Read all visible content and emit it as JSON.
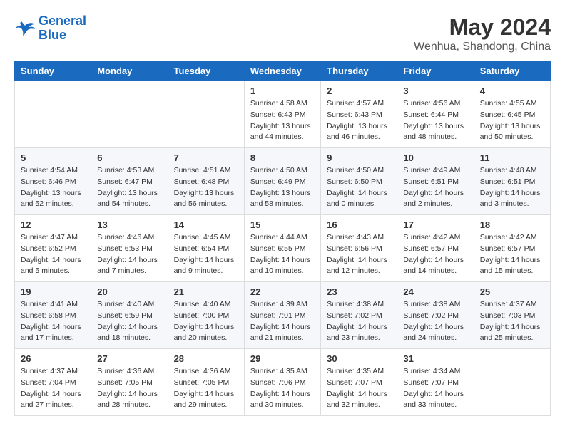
{
  "logo": {
    "line1": "General",
    "line2": "Blue"
  },
  "title": {
    "month_year": "May 2024",
    "location": "Wenhua, Shandong, China"
  },
  "days_of_week": [
    "Sunday",
    "Monday",
    "Tuesday",
    "Wednesday",
    "Thursday",
    "Friday",
    "Saturday"
  ],
  "weeks": [
    [
      {
        "day": "",
        "info": ""
      },
      {
        "day": "",
        "info": ""
      },
      {
        "day": "",
        "info": ""
      },
      {
        "day": "1",
        "info": "Sunrise: 4:58 AM\nSunset: 6:43 PM\nDaylight: 13 hours\nand 44 minutes."
      },
      {
        "day": "2",
        "info": "Sunrise: 4:57 AM\nSunset: 6:43 PM\nDaylight: 13 hours\nand 46 minutes."
      },
      {
        "day": "3",
        "info": "Sunrise: 4:56 AM\nSunset: 6:44 PM\nDaylight: 13 hours\nand 48 minutes."
      },
      {
        "day": "4",
        "info": "Sunrise: 4:55 AM\nSunset: 6:45 PM\nDaylight: 13 hours\nand 50 minutes."
      }
    ],
    [
      {
        "day": "5",
        "info": "Sunrise: 4:54 AM\nSunset: 6:46 PM\nDaylight: 13 hours\nand 52 minutes."
      },
      {
        "day": "6",
        "info": "Sunrise: 4:53 AM\nSunset: 6:47 PM\nDaylight: 13 hours\nand 54 minutes."
      },
      {
        "day": "7",
        "info": "Sunrise: 4:51 AM\nSunset: 6:48 PM\nDaylight: 13 hours\nand 56 minutes."
      },
      {
        "day": "8",
        "info": "Sunrise: 4:50 AM\nSunset: 6:49 PM\nDaylight: 13 hours\nand 58 minutes."
      },
      {
        "day": "9",
        "info": "Sunrise: 4:50 AM\nSunset: 6:50 PM\nDaylight: 14 hours\nand 0 minutes."
      },
      {
        "day": "10",
        "info": "Sunrise: 4:49 AM\nSunset: 6:51 PM\nDaylight: 14 hours\nand 2 minutes."
      },
      {
        "day": "11",
        "info": "Sunrise: 4:48 AM\nSunset: 6:51 PM\nDaylight: 14 hours\nand 3 minutes."
      }
    ],
    [
      {
        "day": "12",
        "info": "Sunrise: 4:47 AM\nSunset: 6:52 PM\nDaylight: 14 hours\nand 5 minutes."
      },
      {
        "day": "13",
        "info": "Sunrise: 4:46 AM\nSunset: 6:53 PM\nDaylight: 14 hours\nand 7 minutes."
      },
      {
        "day": "14",
        "info": "Sunrise: 4:45 AM\nSunset: 6:54 PM\nDaylight: 14 hours\nand 9 minutes."
      },
      {
        "day": "15",
        "info": "Sunrise: 4:44 AM\nSunset: 6:55 PM\nDaylight: 14 hours\nand 10 minutes."
      },
      {
        "day": "16",
        "info": "Sunrise: 4:43 AM\nSunset: 6:56 PM\nDaylight: 14 hours\nand 12 minutes."
      },
      {
        "day": "17",
        "info": "Sunrise: 4:42 AM\nSunset: 6:57 PM\nDaylight: 14 hours\nand 14 minutes."
      },
      {
        "day": "18",
        "info": "Sunrise: 4:42 AM\nSunset: 6:57 PM\nDaylight: 14 hours\nand 15 minutes."
      }
    ],
    [
      {
        "day": "19",
        "info": "Sunrise: 4:41 AM\nSunset: 6:58 PM\nDaylight: 14 hours\nand 17 minutes."
      },
      {
        "day": "20",
        "info": "Sunrise: 4:40 AM\nSunset: 6:59 PM\nDaylight: 14 hours\nand 18 minutes."
      },
      {
        "day": "21",
        "info": "Sunrise: 4:40 AM\nSunset: 7:00 PM\nDaylight: 14 hours\nand 20 minutes."
      },
      {
        "day": "22",
        "info": "Sunrise: 4:39 AM\nSunset: 7:01 PM\nDaylight: 14 hours\nand 21 minutes."
      },
      {
        "day": "23",
        "info": "Sunrise: 4:38 AM\nSunset: 7:02 PM\nDaylight: 14 hours\nand 23 minutes."
      },
      {
        "day": "24",
        "info": "Sunrise: 4:38 AM\nSunset: 7:02 PM\nDaylight: 14 hours\nand 24 minutes."
      },
      {
        "day": "25",
        "info": "Sunrise: 4:37 AM\nSunset: 7:03 PM\nDaylight: 14 hours\nand 25 minutes."
      }
    ],
    [
      {
        "day": "26",
        "info": "Sunrise: 4:37 AM\nSunset: 7:04 PM\nDaylight: 14 hours\nand 27 minutes."
      },
      {
        "day": "27",
        "info": "Sunrise: 4:36 AM\nSunset: 7:05 PM\nDaylight: 14 hours\nand 28 minutes."
      },
      {
        "day": "28",
        "info": "Sunrise: 4:36 AM\nSunset: 7:05 PM\nDaylight: 14 hours\nand 29 minutes."
      },
      {
        "day": "29",
        "info": "Sunrise: 4:35 AM\nSunset: 7:06 PM\nDaylight: 14 hours\nand 30 minutes."
      },
      {
        "day": "30",
        "info": "Sunrise: 4:35 AM\nSunset: 7:07 PM\nDaylight: 14 hours\nand 32 minutes."
      },
      {
        "day": "31",
        "info": "Sunrise: 4:34 AM\nSunset: 7:07 PM\nDaylight: 14 hours\nand 33 minutes."
      },
      {
        "day": "",
        "info": ""
      }
    ]
  ]
}
